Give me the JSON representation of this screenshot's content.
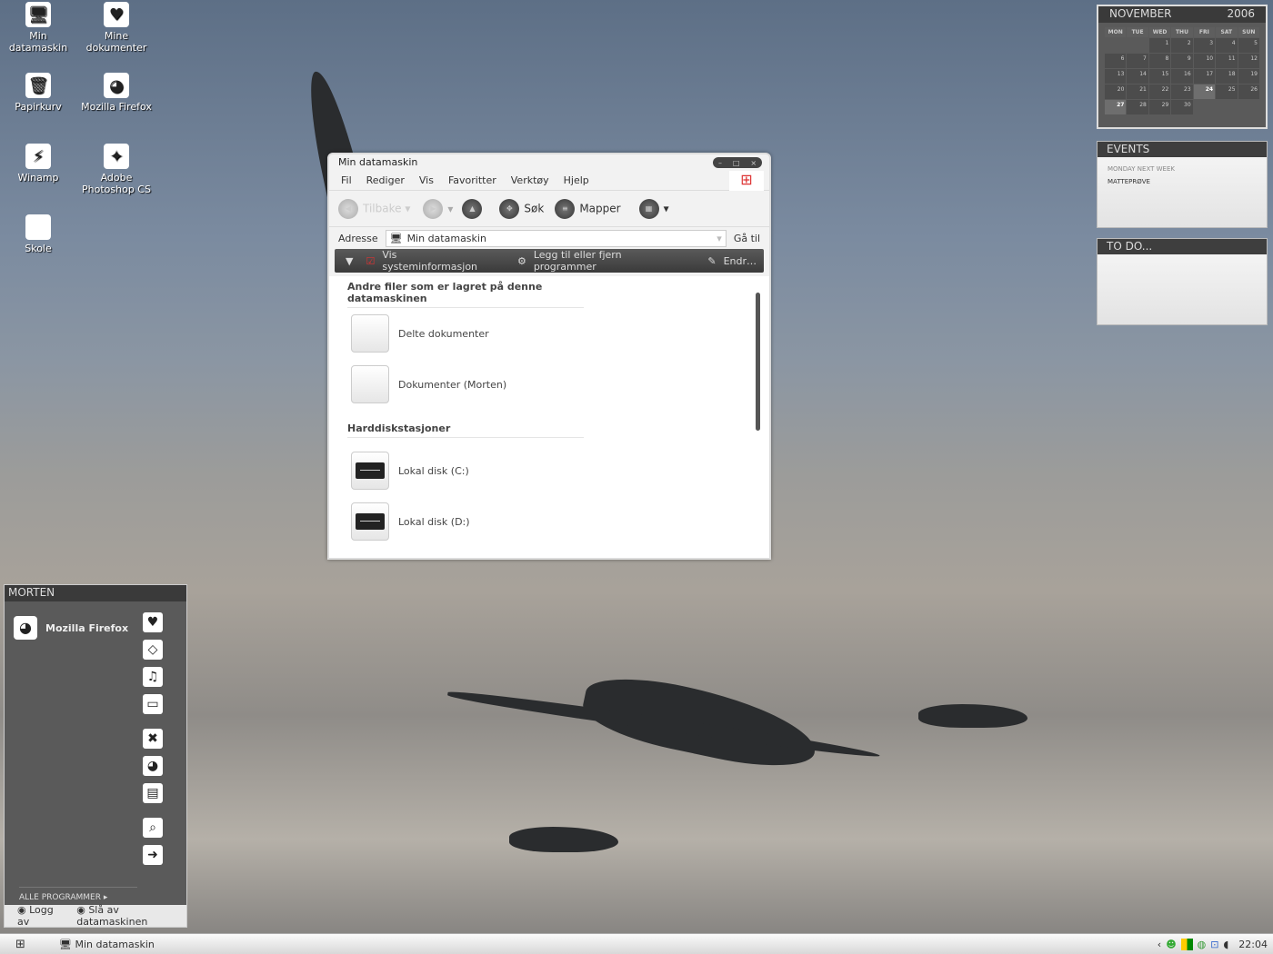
{
  "desktop_icons": [
    {
      "label": "Min datamaskin",
      "glyph": "🖥"
    },
    {
      "label": "Mine dokumenter",
      "glyph": "♥"
    },
    {
      "label": "Papirkurv",
      "glyph": "🗑"
    },
    {
      "label": "Mozilla Firefox",
      "glyph": "◕"
    },
    {
      "label": "Winamp",
      "glyph": "⚡"
    },
    {
      "label": "Adobe Photoshop CS",
      "glyph": "✦"
    },
    {
      "label": "Skole",
      "glyph": ""
    }
  ],
  "calendar": {
    "month": "NOVEMBER",
    "year": "2006",
    "weekdays": [
      "MON",
      "TUE",
      "WED",
      "THU",
      "FRI",
      "SAT",
      "SUN"
    ],
    "first_weekday_index": 2,
    "days": 30,
    "highlighted": [
      24,
      27
    ]
  },
  "events": {
    "title": "EVENTS",
    "heading": "MONDAY NEXT WEEK",
    "item": "MATTEPRØVE"
  },
  "todo": {
    "title": "TO DO..."
  },
  "window": {
    "title": "Min datamaskin",
    "controls": [
      "–",
      "□",
      "×"
    ],
    "menu": [
      "Fil",
      "Rediger",
      "Vis",
      "Favoritter",
      "Verktøy",
      "Hjelp"
    ],
    "toolbar": {
      "back": "Tilbake",
      "search": "Søk",
      "folders": "Mapper"
    },
    "address": {
      "label": "Adresse",
      "value": "Min datamaskin",
      "go": "Gå til"
    },
    "tasks": [
      "Vis systeminformasjon",
      "Legg til eller fjern programmer",
      "Endr…"
    ],
    "sections": [
      {
        "title": "Andre filer som er lagret på denne datamaskinen",
        "items": [
          "Delte dokumenter",
          "Dokumenter (Morten)"
        ]
      },
      {
        "title": "Harddiskstasjoner",
        "items": [
          "Lokal disk (C:)",
          "Lokal disk (D:)"
        ]
      }
    ]
  },
  "start_menu": {
    "user": "MORTEN",
    "pinned": "Mozilla Firefox",
    "all_programs": "ALLE PROGRAMMER",
    "logoff": "Logg av",
    "shutdown": "Slå av datamaskinen"
  },
  "taskbar": {
    "task": "Min datamaskin",
    "clock": "22:04"
  }
}
